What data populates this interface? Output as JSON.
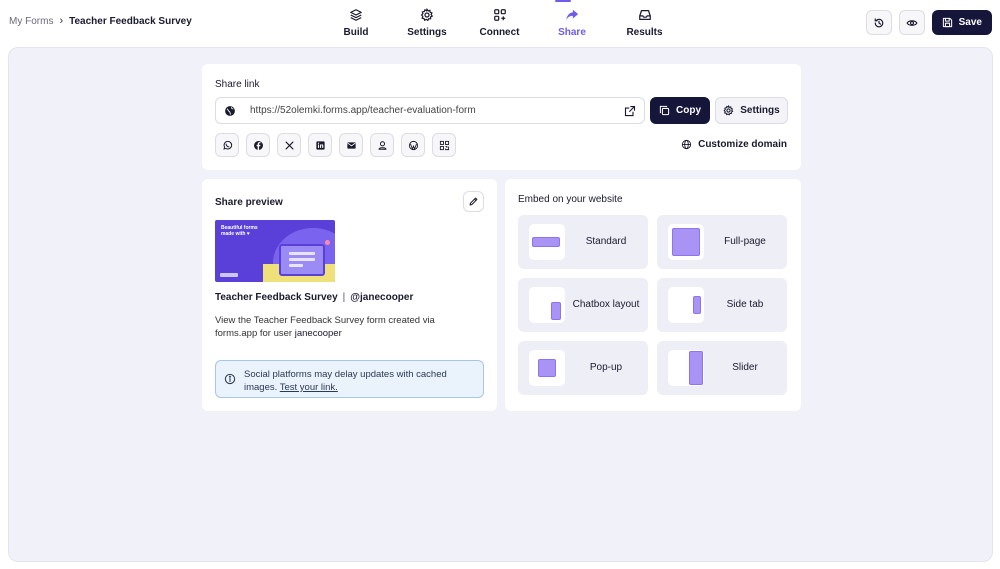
{
  "breadcrumb": {
    "root": "My Forms",
    "separator": "›",
    "current": "Teacher Feedback Survey"
  },
  "nav": {
    "items": [
      {
        "label": "Build",
        "icon": "layers-icon"
      },
      {
        "label": "Settings",
        "icon": "gear-icon"
      },
      {
        "label": "Connect",
        "icon": "apps-plus-icon"
      },
      {
        "label": "Share",
        "icon": "share-arrow-icon",
        "active": true
      },
      {
        "label": "Results",
        "icon": "inbox-icon"
      }
    ],
    "active_color": "#6c5ce7"
  },
  "actions": {
    "save_label": "Save",
    "history_icon": "history-icon",
    "preview_icon": "eye-icon",
    "save_icon": "floppy-icon"
  },
  "share_link": {
    "title": "Share link",
    "url": "https://52olemki.forms.app/teacher-evaluation-form",
    "copy_label": "Copy",
    "settings_label": "Settings",
    "customize_label": "Customize domain",
    "social": [
      "whatsapp-icon",
      "facebook-icon",
      "x-icon",
      "linkedin-icon",
      "email-icon",
      "user-icon",
      "wordpress-icon",
      "qr-code-icon"
    ]
  },
  "share_preview": {
    "title": "Share preview",
    "thumb_text": "Beautiful forms made with ♥",
    "form_name": "Teacher Feedback Survey",
    "separator": "|",
    "handle": "@janecooper",
    "description": "View the Teacher Feedback Survey form created via forms.app for user",
    "user": "janecooper",
    "info_text": "Social platforms may delay updates with cached images.",
    "info_link": "Test your link."
  },
  "embed": {
    "title": "Embed on your website",
    "options": [
      {
        "label": "Standard"
      },
      {
        "label": "Full-page"
      },
      {
        "label": "Chatbox layout"
      },
      {
        "label": "Side tab"
      },
      {
        "label": "Pop-up"
      },
      {
        "label": "Slider"
      }
    ]
  },
  "colors": {
    "primary_dark": "#16163a",
    "accent": "#6c5ce7",
    "canvas_bg": "#f1f1f9",
    "embed_shape": "#a993f5"
  }
}
